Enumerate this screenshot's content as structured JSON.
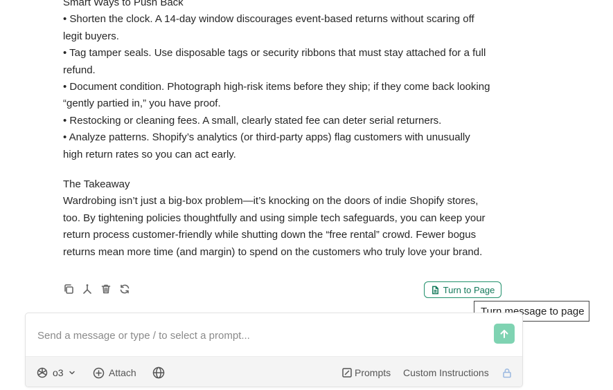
{
  "message": {
    "paragraphs": [
      "Smart Ways to Push Back",
      "• Shorten the clock. A 14-day window discourages event-based returns without scaring off legit buyers.",
      "• Tag tamper seals. Use disposable tags or security ribbons that must stay attached for a full refund.",
      "• Document condition. Photograph high-risk items before they ship; if they come back looking “gently partied in,” you have proof.",
      "• Restocking or cleaning fees. A small, clearly stated fee can deter serial returners.",
      "• Analyze patterns. Shopify’s analytics (or third-party apps) flag customers with unusually high return rates so you can act early.",
      "The Takeaway",
      "Wardrobing isn’t just a big-box problem—it’s knocking on the doors of indie Shopify stores, too. By tightening policies thoughtfully and using simple tech safeguards, you can keep your return process customer-friendly while shutting down the “free rental” crowd. Fewer bogus returns mean more time (and margin) to spend on the customers who truly love your brand."
    ]
  },
  "actions": {
    "icons": [
      "copy-icon",
      "fork-icon",
      "trash-icon",
      "regenerate-icon"
    ],
    "turn_to_page_label": "Turn to Page",
    "tooltip": "Turn message to page"
  },
  "composer": {
    "placeholder": "Send a message or type / to select a prompt...",
    "value": "",
    "model_label": "o3",
    "attach_label": "Attach",
    "prompts_label": "Prompts",
    "custom_instructions_label": "Custom Instructions"
  },
  "colors": {
    "accent": "#13795a",
    "send_button": "#7fd3b2",
    "toolbar_bg": "#f4f4f4"
  }
}
